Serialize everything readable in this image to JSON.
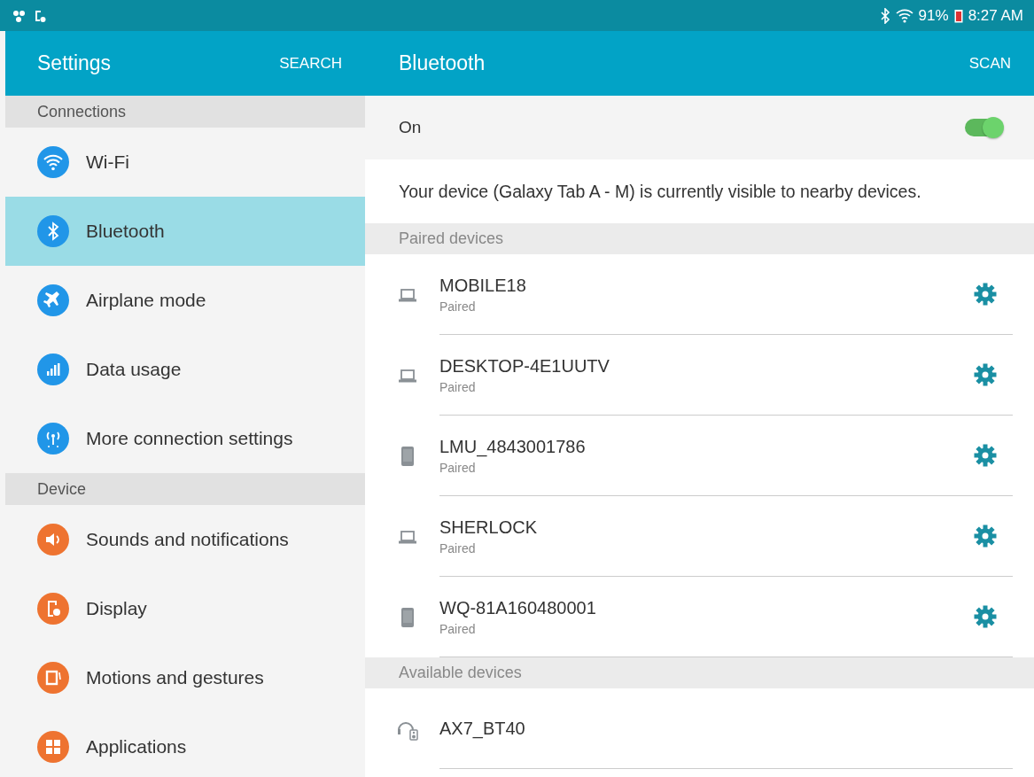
{
  "status_bar": {
    "battery": "91%",
    "time": "8:27 AM"
  },
  "sidebar": {
    "title": "Settings",
    "action": "SEARCH",
    "sections": [
      {
        "header": "Connections",
        "items": [
          {
            "label": "Wi-Fi",
            "kind": "wifi",
            "color": "#2196e8",
            "selected": false
          },
          {
            "label": "Bluetooth",
            "kind": "bluetooth",
            "color": "#2196e8",
            "selected": true
          },
          {
            "label": "Airplane mode",
            "kind": "airplane",
            "color": "#2196e8",
            "selected": false
          },
          {
            "label": "Data usage",
            "kind": "data",
            "color": "#2196e8",
            "selected": false
          },
          {
            "label": "More connection settings",
            "kind": "antenna",
            "color": "#2196e8",
            "selected": false
          }
        ]
      },
      {
        "header": "Device",
        "items": [
          {
            "label": "Sounds and notifications",
            "kind": "sound",
            "color": "#ee7330",
            "selected": false
          },
          {
            "label": "Display",
            "kind": "display",
            "color": "#ee7330",
            "selected": false
          },
          {
            "label": "Motions and gestures",
            "kind": "motion",
            "color": "#ee7330",
            "selected": false
          },
          {
            "label": "Applications",
            "kind": "apps",
            "color": "#ee7330",
            "selected": false
          }
        ]
      }
    ]
  },
  "main": {
    "title": "Bluetooth",
    "action": "SCAN",
    "switch": {
      "label": "On",
      "on": true
    },
    "visibility": "Your device (Galaxy Tab A - M) is currently visible to nearby devices.",
    "sections": [
      {
        "header": "Paired devices",
        "devices": [
          {
            "name": "MOBILE18",
            "status": "Paired",
            "kind": "laptop"
          },
          {
            "name": "DESKTOP-4E1UUTV",
            "status": "Paired",
            "kind": "laptop"
          },
          {
            "name": "LMU_4843001786",
            "status": "Paired",
            "kind": "phone"
          },
          {
            "name": "SHERLOCK",
            "status": "Paired",
            "kind": "laptop"
          },
          {
            "name": "WQ-81A160480001",
            "status": "Paired",
            "kind": "phone"
          }
        ]
      },
      {
        "header": "Available devices",
        "devices": [
          {
            "name": "AX7_BT40",
            "kind": "headset"
          }
        ]
      }
    ]
  }
}
